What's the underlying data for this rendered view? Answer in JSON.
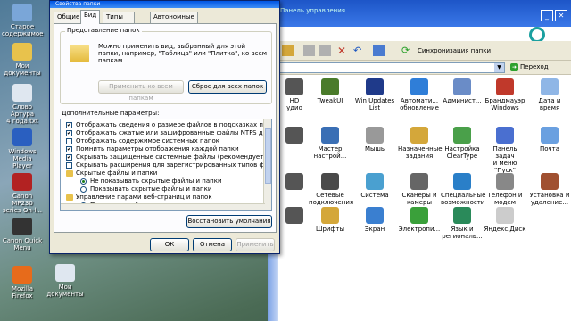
{
  "desktop": {
    "icons": [
      {
        "label": "Старое\nсодержимое",
        "color": "#7aa6d8"
      },
      {
        "label": "Мои\nдокументы",
        "color": "#e8c24c"
      },
      {
        "label": "Слово Артура\n4 года.txt",
        "color": "#dfe7f0"
      },
      {
        "label": "Windows Media\nPlayer",
        "color": "#2a5fc0"
      },
      {
        "label": "Canon MP230\nseries On-l...",
        "color": "#b22222"
      },
      {
        "label": "Canon Quick\nMenu",
        "color": "#333333"
      },
      {
        "label": "Mozilla Firefox",
        "color": "#e76b1b"
      },
      {
        "label": "Мои\nдокументы",
        "color": "#dfe7f0"
      }
    ]
  },
  "control_panel": {
    "title": "Панель управления",
    "toolbar": {
      "sync_label": "Синхронизация папки"
    },
    "address": {
      "go_label": "Переход"
    },
    "items": [
      {
        "label": "HD\nудио",
        "color": "#555555"
      },
      {
        "label": "TweakUI",
        "color": "#4a7b2a"
      },
      {
        "label": "Win Updates\nList",
        "color": "#1f3a8a"
      },
      {
        "label": "Автомати...\nобновление",
        "color": "#2f7ed8"
      },
      {
        "label": "Админист...",
        "color": "#6a8cc7"
      },
      {
        "label": "Брандмауэр\nWindows",
        "color": "#c0392b"
      },
      {
        "label": "Дата и время",
        "color": "#8fb6e6"
      },
      {
        "label": "",
        "color": "#555555"
      },
      {
        "label": "Мастер\nнастрой...",
        "color": "#3a6fb5"
      },
      {
        "label": "Мышь",
        "color": "#999999"
      },
      {
        "label": "Назначенные\nзадания",
        "color": "#d4a73a"
      },
      {
        "label": "Настройка\nClearType",
        "color": "#4aa04a"
      },
      {
        "label": "Панель задач\nи меню \"Пуск\"",
        "color": "#4a6fd0"
      },
      {
        "label": "Почта",
        "color": "#6aa0e0"
      },
      {
        "label": "",
        "color": "#555555"
      },
      {
        "label": "Сетевые\nподключения",
        "color": "#4a4a4a"
      },
      {
        "label": "Система",
        "color": "#4aa0d0"
      },
      {
        "label": "Сканеры и\nкамеры",
        "color": "#666666"
      },
      {
        "label": "Специальные\nвозможности",
        "color": "#2a7fc8"
      },
      {
        "label": "Телефон и\nмодем",
        "color": "#888888"
      },
      {
        "label": "Установка и\nудаление...",
        "color": "#a05030"
      },
      {
        "label": "",
        "color": "#555555"
      },
      {
        "label": "Шрифты",
        "color": "#d4a73a"
      },
      {
        "label": "Экран",
        "color": "#3a7fd0"
      },
      {
        "label": "Электропи...",
        "color": "#3aa03a"
      },
      {
        "label": "Язык и\nрегиональ...",
        "color": "#2a8a5a"
      },
      {
        "label": "Яндекс.Диск",
        "color": "#cccccc"
      }
    ]
  },
  "dialog": {
    "title": "Свойства папки",
    "tabs": [
      "Общие",
      "Вид",
      "Типы файлов",
      "Автономные файлы"
    ],
    "group_title": "Представление папок",
    "group_desc": "Можно применить вид, выбранный для этой папки, например, \"Таблица\" или \"Плитка\", ко всем папкам.",
    "apply_all_label": "Применить ко всем папкам",
    "reset_all_label": "Сброс для всех папок",
    "advanced_label": "Дополнительные параметры:",
    "advanced_items": [
      {
        "type": "checkbox",
        "checked": true,
        "indent": 1,
        "text": "Отображать сведения о размере файлов в подсказках па"
      },
      {
        "type": "checkbox",
        "checked": true,
        "indent": 1,
        "text": "Отображать сжатые или зашифрованные файлы NTFS др"
      },
      {
        "type": "checkbox",
        "checked": false,
        "indent": 1,
        "text": "Отображать содержимое системных папок"
      },
      {
        "type": "checkbox",
        "checked": true,
        "indent": 1,
        "text": "Помнить параметры отображения каждой папки"
      },
      {
        "type": "checkbox",
        "checked": true,
        "indent": 1,
        "text": "Скрывать защищенные системные файлы (рекомендуетс"
      },
      {
        "type": "checkbox",
        "checked": false,
        "indent": 1,
        "text": "Скрывать расширения для зарегистрированных типов фа"
      },
      {
        "type": "folder",
        "indent": 1,
        "text": "Скрытые файлы и папки"
      },
      {
        "type": "radio",
        "checked": true,
        "indent": 2,
        "text": "Не показывать скрытые файлы и папки"
      },
      {
        "type": "radio",
        "checked": false,
        "indent": 2,
        "text": "Показывать скрытые файлы и папки"
      },
      {
        "type": "folder",
        "indent": 1,
        "text": "Управление парами веб-страниц и папок"
      },
      {
        "type": "radio",
        "checked": false,
        "indent": 2,
        "text": "Показывать оба компонента, управлять как одним фа"
      }
    ],
    "restore_label": "Восстановить умолчания",
    "ok_label": "ОК",
    "cancel_label": "Отмена",
    "apply_label": "Применить"
  }
}
